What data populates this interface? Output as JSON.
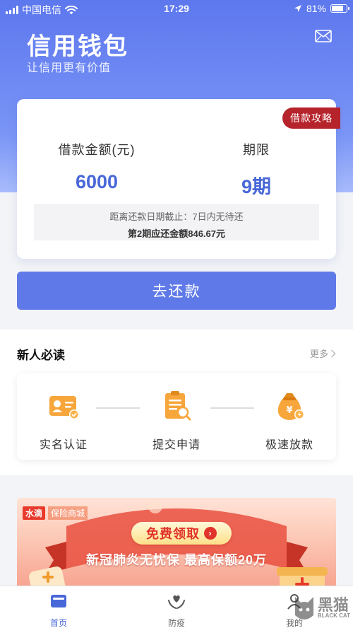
{
  "status_bar": {
    "carrier": "中国电信",
    "time": "17:29",
    "battery": "81%",
    "battery_level": 0.81
  },
  "header": {
    "title": "信用钱包",
    "subtitle": "让信用更有价值",
    "mail_icon": "mail-icon"
  },
  "loan_card": {
    "guide_badge": "借款攻略",
    "amount_label": "借款金额(元)",
    "amount_value": "6000",
    "term_label": "期限",
    "term_value": "9期",
    "due_text": "距离还款日期截止：7日内无待还",
    "installment_text": "第2期应还金额846.67元"
  },
  "actions": {
    "repay_label": "去还款"
  },
  "guide": {
    "title": "新人必读",
    "more_label": "更多",
    "steps": [
      {
        "label": "实名认证",
        "icon": "id-card-icon"
      },
      {
        "label": "提交申请",
        "icon": "clipboard-icon"
      },
      {
        "label": "极速放款",
        "icon": "money-bag-icon"
      }
    ]
  },
  "banner": {
    "brand": "水滴",
    "mall": "保险商城",
    "cta": "免费领取",
    "headline": "新冠肺炎无忧保 最高保额20万"
  },
  "tabs": [
    {
      "label": "首页",
      "icon": "home-card-icon",
      "active": true
    },
    {
      "label": "防疫",
      "icon": "heart-hands-icon",
      "active": false
    },
    {
      "label": "我的",
      "icon": "user-icon",
      "active": false
    }
  ],
  "watermark": {
    "text": "黑猫",
    "subtext": "BLACK CAT"
  },
  "colors": {
    "primary": "#5f7ae8",
    "accent_red": "#b5232b",
    "value_blue": "#4968d8"
  }
}
